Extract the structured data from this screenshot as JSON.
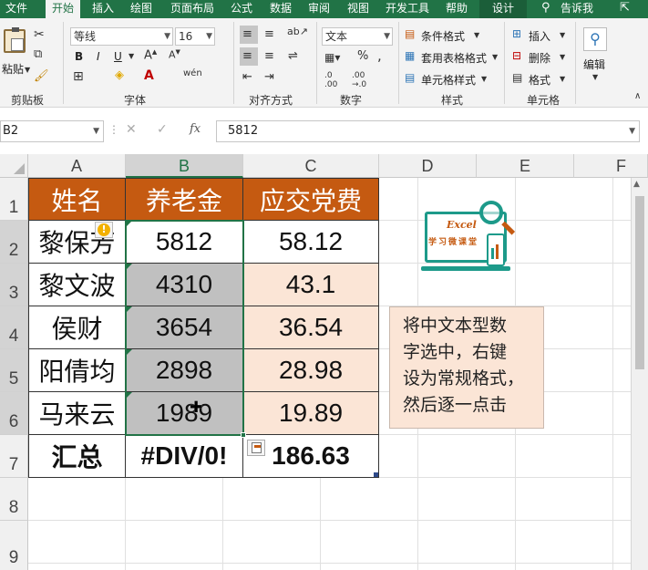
{
  "tabs": [
    "文件",
    "开始",
    "插入",
    "绘图",
    "页面布局",
    "公式",
    "数据",
    "审阅",
    "视图",
    "开发工具",
    "帮助",
    "设计"
  ],
  "tell_me": "告诉我",
  "ribbon": {
    "paste_label": "粘贴",
    "clipboard_label": "剪贴板",
    "font_name": "等线",
    "font_size": "16",
    "bold": "B",
    "italic": "I",
    "underline": "U",
    "font_group_label": "字体",
    "align_group_label": "对齐方式",
    "number_format": "文本",
    "number_group_label": "数字",
    "conditional_format": "条件格式",
    "table_format": "套用表格格式",
    "cell_styles": "单元格样式",
    "styles_group_label": "样式",
    "insert": "插入",
    "delete": "删除",
    "format": "格式",
    "cells_group_label": "单元格",
    "edit_label": "编辑"
  },
  "formula_bar": {
    "name_box": "B2",
    "fx": "fx",
    "value": "5812"
  },
  "columns": [
    "A",
    "B",
    "C",
    "D",
    "E",
    "F"
  ],
  "rows": [
    "1",
    "2",
    "3",
    "4",
    "5",
    "6",
    "7",
    "8",
    "9"
  ],
  "table": {
    "headers": [
      "姓名",
      "养老金",
      "应交党费"
    ],
    "names": [
      "黎保芳",
      "黎文波",
      "侯财",
      "阳倩均",
      "马来云"
    ],
    "pension": [
      "5812",
      "4310",
      "3654",
      "2898",
      "1989"
    ],
    "dues": [
      "58.12",
      "43.1",
      "36.54",
      "28.98",
      "19.89"
    ],
    "total_label": "汇总",
    "total_pension": "#DIV/0!",
    "total_dues": "186.63"
  },
  "logo_text": "Excel",
  "logo_sub": "学习微课堂",
  "note": [
    "将中文本型数",
    "字选中，右键",
    "设为常规格式，",
    "然后逐一点击"
  ],
  "colors": {
    "header_bg": "#c55a11",
    "peach": "#fbe5d6",
    "accent": "#217346"
  }
}
